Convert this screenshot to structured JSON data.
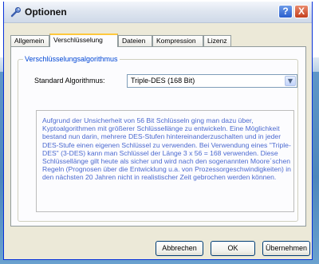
{
  "window": {
    "title": "Optionen",
    "help_label": "?",
    "close_label": "X",
    "icon": "wrench-icon"
  },
  "tabs": [
    {
      "label": "Allgemein"
    },
    {
      "label": "Verschlüsselung",
      "active": true
    },
    {
      "label": "Dateien"
    },
    {
      "label": "Kompression"
    },
    {
      "label": "Lizenz"
    }
  ],
  "group": {
    "legend": "Verschlüsselungsalgorithmus",
    "algorithm_label": "Standard Algorithmus:",
    "algorithm_value": "Triple-DES (168 Bit)",
    "description": "Aufgrund der Unsicherheit von 56 Bit Schlüsseln ging man dazu über, Kyptoalgorithmen mit größerer Schlüssellänge zu entwickeln. Eine Möglichkeit bestand nun darin, mehrere DES-Stufen hintereinanderzuschalten und in jeder DES-Stufe einen eigenen Schlüssel zu verwenden. Bei Verwendung eines \"Triple-DES\" (3-DES) kann man Schlüssel der Länge 3 x 56 = 168 verwenden. Diese Schlüssellänge gilt heute als sicher und wird nach den sogenannten Moore´schen Regeln (Prognosen über die Entwicklung u.a. von Prozessorgeschwindigkeiten) in den nächsten 20 Jahren nicht in realistischer Zeit gebrochen werden können."
  },
  "buttons": {
    "cancel": "Abbrechen",
    "ok": "OK",
    "apply": "Übernehmen"
  },
  "colors": {
    "accent": "#0046d5",
    "description_text": "#4c6ad0",
    "active_tab_highlight": "#ffc83c"
  }
}
